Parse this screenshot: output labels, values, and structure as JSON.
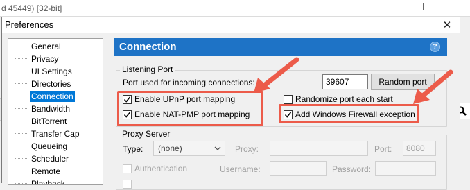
{
  "bg_window": {
    "title": "d 45449) [32-bit]"
  },
  "dialog": {
    "title": "Preferences",
    "close_glyph": "✕"
  },
  "tree": {
    "items": [
      "General",
      "Privacy",
      "UI Settings",
      "Directories",
      "Connection",
      "Bandwidth",
      "BitTorrent",
      "Transfer Cap",
      "Queueing",
      "Scheduler",
      "Remote",
      "Playback"
    ],
    "selected": "Connection"
  },
  "pane": {
    "title": "Connection",
    "help_icon": "question-icon",
    "header_color": "#1e73c6"
  },
  "listening_port": {
    "group_title": "Listening Port",
    "port_label": "Port used for incoming connections:",
    "port_value": "39607",
    "random_port_button": "Random port",
    "enable_upnp": {
      "label": "Enable UPnP port mapping",
      "checked": true
    },
    "enable_natpmp": {
      "label": "Enable NAT-PMP port mapping",
      "checked": true
    },
    "randomize_port": {
      "label": "Randomize port each start",
      "checked": false
    },
    "add_firewall": {
      "label": "Add Windows Firewall exception",
      "checked": true
    }
  },
  "proxy_server": {
    "group_title": "Proxy Server",
    "type_label": "Type:",
    "type_value": "(none)",
    "proxy_label": "Proxy:",
    "proxy_value": "",
    "port_label": "Port:",
    "port_value": "8080",
    "authentication": {
      "label": "Authentication",
      "checked": false
    },
    "username_label": "Username:",
    "username_value": "",
    "password_label": "Password:",
    "password_value": ""
  },
  "annotation": {
    "color": "#ec5b4a"
  }
}
